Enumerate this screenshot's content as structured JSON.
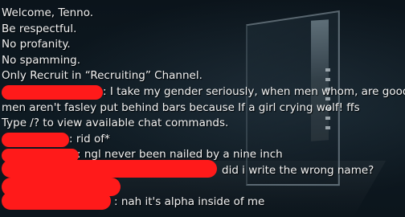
{
  "chat": {
    "lines": [
      {
        "text": "Welcome, Tenno."
      },
      {
        "text": "Be respectful."
      },
      {
        "text": "No profanity."
      },
      {
        "text": "No spamming."
      },
      {
        "text": "Only Recruit in “Recruiting” Channel."
      },
      {
        "text": ": I take my gender seriously, when men whom, are good"
      },
      {
        "text": "men aren't fasley put behind bars because If a girl crying wolf! ffs"
      },
      {
        "text": "Type /? to view available chat commands."
      },
      {
        "text": ": rid of*"
      },
      {
        "text": ": ngl never been nailed by a nine inch"
      },
      {
        "text": "did i write the wrong name?"
      },
      {
        "text": ""
      },
      {
        "text": ": nah it's alpha inside of me"
      }
    ]
  },
  "colors": {
    "text": "#f2f2f2",
    "redaction": "#ff1a1a",
    "background": "#0d1720"
  }
}
